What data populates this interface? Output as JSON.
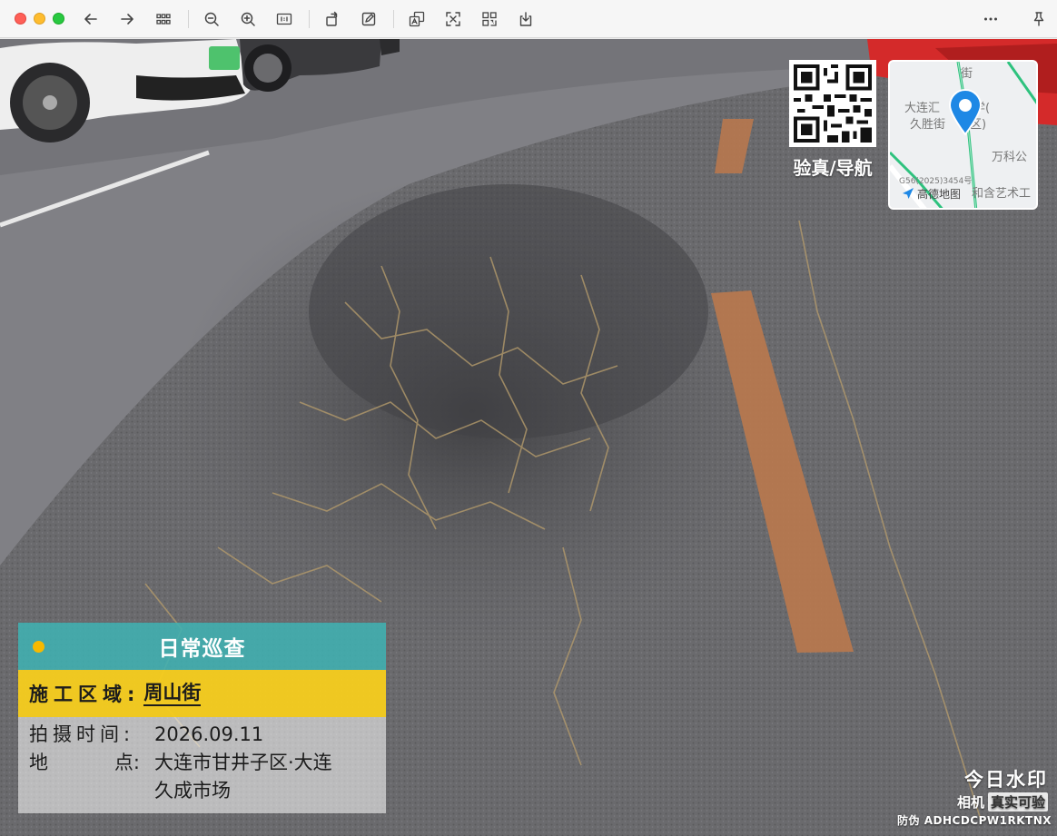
{
  "toolbar": {
    "buttons": [
      {
        "name": "back-button",
        "icon": "arrow-left-icon"
      },
      {
        "name": "forward-button",
        "icon": "arrow-right-icon"
      },
      {
        "name": "grid-view-button",
        "icon": "grid-icon"
      },
      {
        "name": "zoom-out-button",
        "icon": "zoom-out-icon"
      },
      {
        "name": "zoom-in-button",
        "icon": "zoom-in-icon"
      },
      {
        "name": "actual-size-button",
        "icon": "actual-size-icon"
      },
      {
        "name": "rotate-button",
        "icon": "rotate-icon"
      },
      {
        "name": "edit-button",
        "icon": "edit-icon"
      },
      {
        "name": "translate-button",
        "icon": "translate-icon"
      },
      {
        "name": "ocr-button",
        "icon": "text-scan-icon"
      },
      {
        "name": "qr-scan-button",
        "icon": "qr-scan-icon"
      },
      {
        "name": "download-button",
        "icon": "download-icon"
      },
      {
        "name": "more-button",
        "icon": "more-icon"
      },
      {
        "name": "pin-button",
        "icon": "pin-icon"
      }
    ]
  },
  "watermark": {
    "title": "日常巡查",
    "area_label": "施工区域:",
    "area_value": "周山街",
    "time_label": "拍摄时间:",
    "time_value": "2026.09.11",
    "place_label_1": "地",
    "place_label_2": "点:",
    "place_value_1": "大连市甘井子区·大连",
    "place_value_2": "久成市场",
    "colors": {
      "header": "#40b0b2",
      "highlight": "#f7cd1e",
      "dot": "#f7b900"
    }
  },
  "qr": {
    "label": "验真/导航"
  },
  "map": {
    "street_1": "街",
    "place_1": "大连汇",
    "place_1b": "学(",
    "place_2": "久胜街",
    "place_2b": "区)",
    "place_3": "万科公",
    "place_4": "和含艺术工",
    "road_code": "G56(2025)3454号",
    "brand": "高德地图",
    "pin_color": "#1e88e5"
  },
  "brand": {
    "main": "今日水印",
    "sub_a": "相机",
    "sub_b": "真实可验",
    "code": "防伪 ADHCDCPW1RKTNX"
  }
}
